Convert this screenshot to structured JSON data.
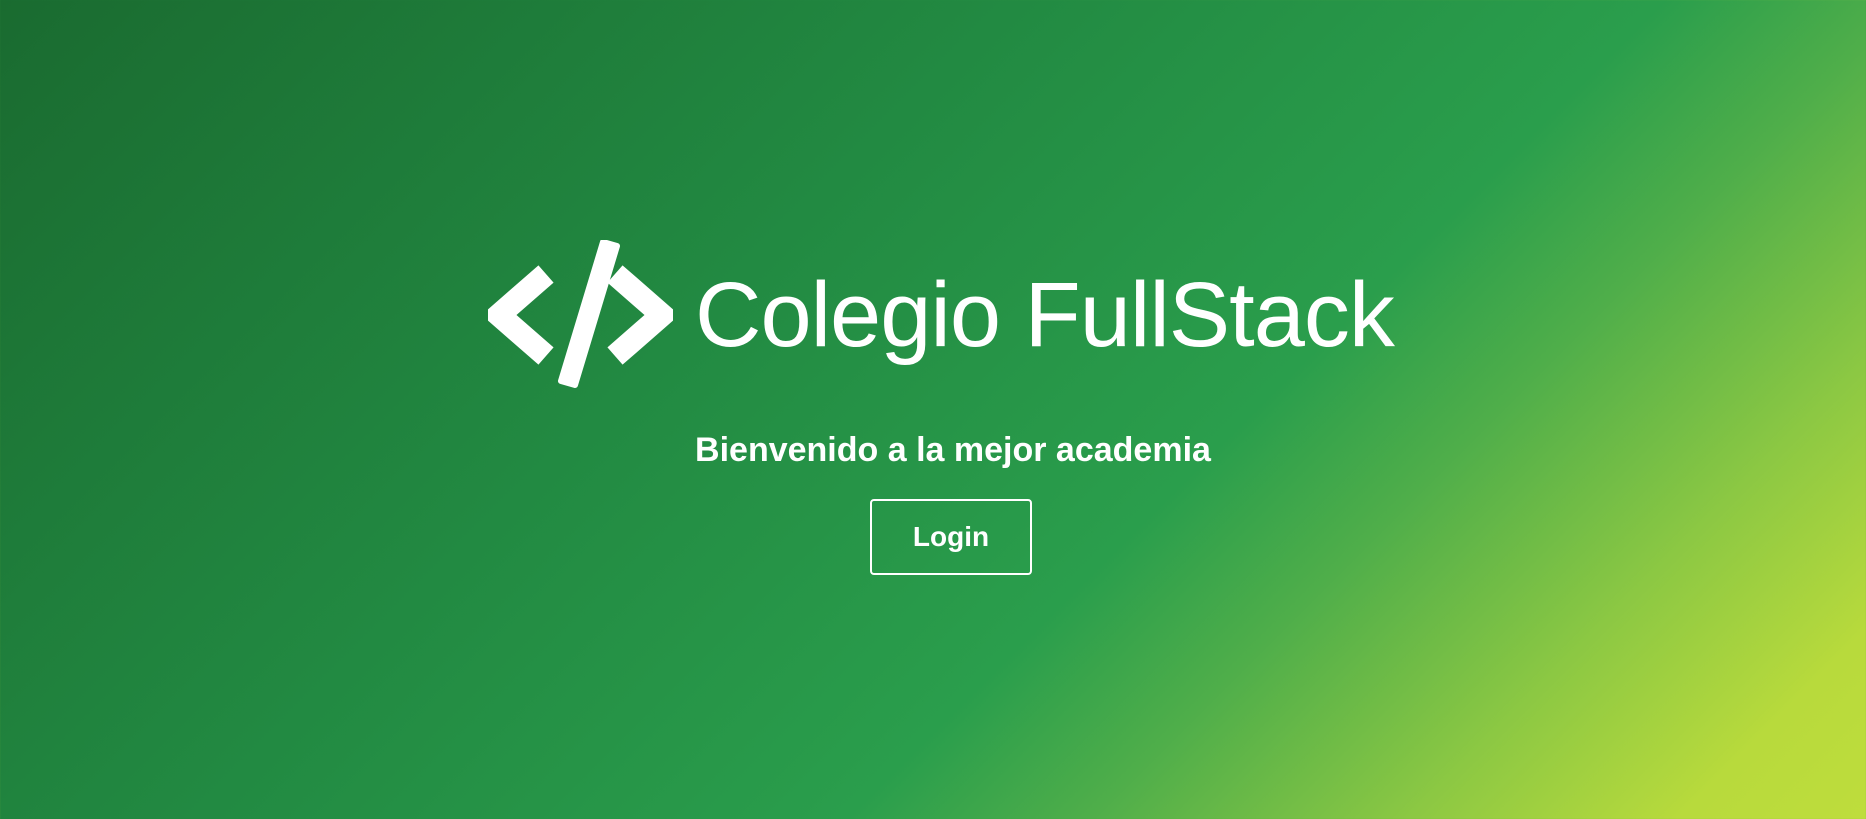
{
  "brand": {
    "logo_icon": "code-brackets-icon",
    "name": "Colegio FullStack"
  },
  "hero": {
    "subtitle": "Bienvenido a la mejor academia",
    "login_label": "Login"
  },
  "colors": {
    "text": "#ffffff",
    "gradient_start": "#1a6b30",
    "gradient_mid": "#2a9e4c",
    "gradient_end": "#bedd3c"
  }
}
